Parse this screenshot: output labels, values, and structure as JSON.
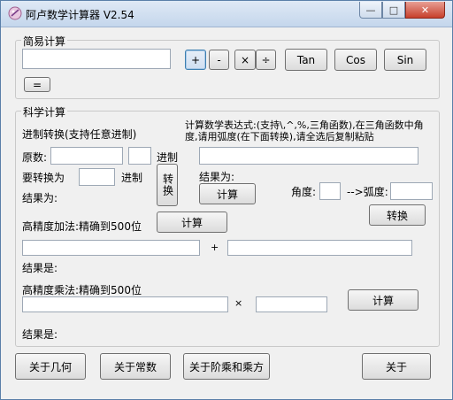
{
  "window": {
    "title": "阿卢数学计算器 V2.54",
    "minimize_glyph": "—",
    "maximize_glyph": "□",
    "close_glyph": "✕",
    "icon": "calculator-icon",
    "accent": "#c7402c"
  },
  "simple": {
    "group_label": "简易计算",
    "input_value": "",
    "ops": {
      "plus": "+",
      "minus": "-",
      "times": "×",
      "divide": "÷"
    },
    "tan": "Tan",
    "cos": "Cos",
    "sin": "Sin",
    "equals": "="
  },
  "science": {
    "group_label": "科学计算",
    "base_title": "进制转换(支持任意进制)",
    "original_label": "原数:",
    "original_value": "",
    "original_base": "",
    "base_suffix": "进制",
    "target_label": "要转换为",
    "target_base": "",
    "target_suffix": "进制",
    "convert_button": "转换",
    "result_label": "结果为:",
    "expr_title": "计算数学表达式:(支持\\,^,%,三角函数),在三角函数中角度,请用弧度(在下面转换),请全选后复制粘贴",
    "expr_value": "",
    "expr_result_label": "结果为:",
    "expr_calc_button": "计算",
    "angle_label": "角度:",
    "angle_value": "",
    "radian_label": "-->弧度:",
    "radian_value": "",
    "angle_convert_button": "转换",
    "add_title": "高精度加法:精确到500位",
    "add_calc_button": "计算",
    "add_a": "",
    "add_b": "",
    "add_op": "+",
    "add_result_label": "结果是:",
    "mul_title": "高精度乘法:精确到500位",
    "mul_a": "",
    "mul_b": "",
    "mul_op": "×",
    "mul_calc_button": "计算",
    "mul_result_label": "结果是:"
  },
  "footer": {
    "geometry": "关于几何",
    "constants": "关于常数",
    "factorial": "关于阶乘和乘方",
    "about": "关于"
  }
}
